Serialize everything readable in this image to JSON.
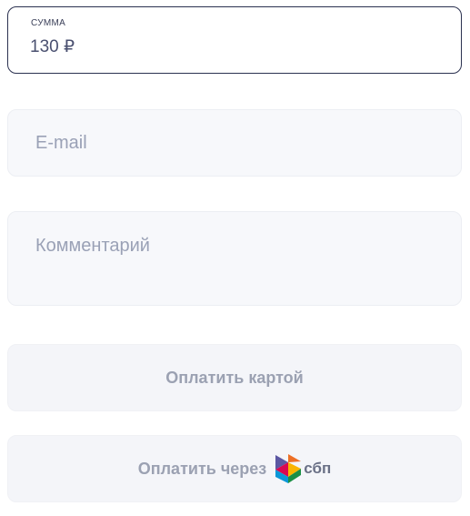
{
  "amount": {
    "label": "СУММА",
    "value": "130 ₽"
  },
  "email": {
    "placeholder": "E-mail"
  },
  "comment": {
    "placeholder": "Комментарий"
  },
  "buttons": {
    "card_label": "Оплатить картой",
    "sbp_label": "Оплатить через",
    "sbp_logo_text": "сбп"
  },
  "colors": {
    "accent_border": "#2b3150",
    "field_bg": "#f7f8fb",
    "button_text": "#9ba1b2",
    "placeholder": "#9aa1b6"
  }
}
